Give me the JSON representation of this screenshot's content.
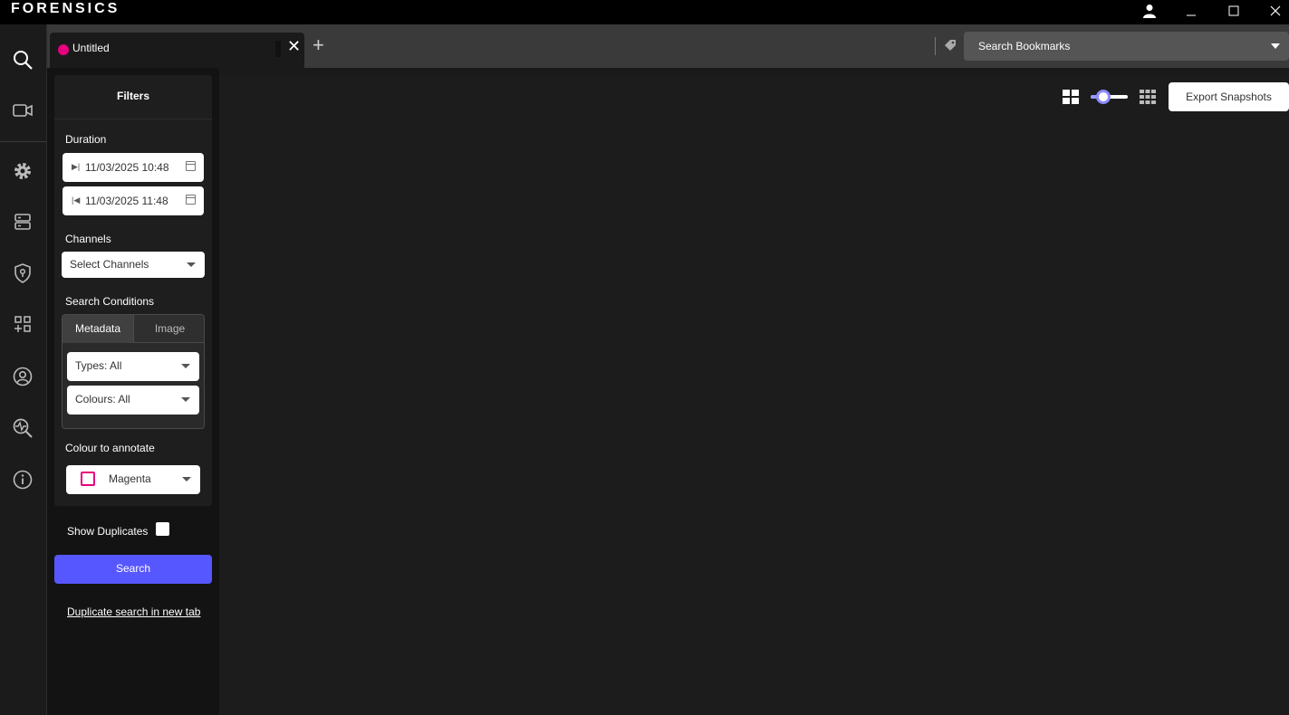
{
  "app": {
    "title": "FORENSICS"
  },
  "tab": {
    "label": "Untitled",
    "dot_color": "#e6007e"
  },
  "bookmarks": {
    "placeholder": "Search Bookmarks"
  },
  "filters": {
    "title": "Filters",
    "duration_label": "Duration",
    "start_value": "11/03/2025 10:48",
    "end_value": "11/03/2025 11:48",
    "channels_label": "Channels",
    "channels_value": "Select Channels",
    "conditions_label": "Search Conditions",
    "tabs": [
      "Metadata",
      "Image"
    ],
    "types_value": "Types: All",
    "colours_value": "Colours: All",
    "annotate_label": "Colour to annotate",
    "annotate_value": "Magenta",
    "annotate_color": "#e6007e"
  },
  "show_duplicates_label": "Show Duplicates",
  "search_label": "Search",
  "duplicate_link": "Duplicate search in new tab",
  "export_label": "Export Snapshots",
  "accent_color": "#5757ff"
}
